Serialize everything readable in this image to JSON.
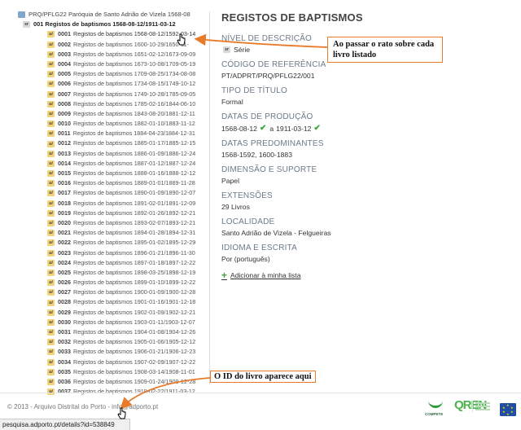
{
  "tree": {
    "root": {
      "code": "PRQ/PFLG22",
      "label": "Paróquia de Santo Adrião de Vizela 1568-08"
    },
    "book": {
      "code": "001",
      "label": "Registos de baptismos 1568-08-12/1911-03-12"
    },
    "items": [
      {
        "code": "0001",
        "label": "Registos de baptismos 1568-08-12/1592-03-14"
      },
      {
        "code": "0002",
        "label": "Registos de baptismos 1600-10-29/1650-11-"
      },
      {
        "code": "0003",
        "label": "Registos de baptismos 1651-02-12/1673-09-09"
      },
      {
        "code": "0004",
        "label": "Registos de baptismos 1673-10-08/1709-05-19"
      },
      {
        "code": "0005",
        "label": "Registos de baptismos 1709-08-25/1734-08-08"
      },
      {
        "code": "0006",
        "label": "Registos de baptismos 1734-08-15/1749-10-12"
      },
      {
        "code": "0007",
        "label": "Registos de baptismos 1749-10-28/1785-09-05"
      },
      {
        "code": "0008",
        "label": "Registos de baptismos 1785-02-16/1844-06-10"
      },
      {
        "code": "0009",
        "label": "Registos de baptismos 1843-08-20/1881-12-11"
      },
      {
        "code": "0010",
        "label": "Registos de baptismos 1882-01-10/1883-11-12"
      },
      {
        "code": "0011",
        "label": "Registos de baptismos 1884-04-23/1884-12-31"
      },
      {
        "code": "0012",
        "label": "Registos de baptismos 1885-01-17/1885-12-15"
      },
      {
        "code": "0013",
        "label": "Registos de baptismos 1886-01-09/1886-12-24"
      },
      {
        "code": "0014",
        "label": "Registos de baptismos 1887-01-12/1887-12-24"
      },
      {
        "code": "0015",
        "label": "Registos de baptismos 1888-01-16/1888-12-12"
      },
      {
        "code": "0016",
        "label": "Registos de baptismos 1889-01-01/1889-11-28"
      },
      {
        "code": "0017",
        "label": "Registos de baptismos 1890-01-09/1890-12-07"
      },
      {
        "code": "0018",
        "label": "Registos de baptismos 1891-02-01/1891-12-09"
      },
      {
        "code": "0019",
        "label": "Registos de baptismos 1892-01-26/1892-12-21"
      },
      {
        "code": "0020",
        "label": "Registos de baptismos 1893-02-07/1893-12-21"
      },
      {
        "code": "0021",
        "label": "Registos de baptismos 1894-01-28/1894-12-31"
      },
      {
        "code": "0022",
        "label": "Registos de baptismos 1895-01-02/1895-12-29"
      },
      {
        "code": "0023",
        "label": "Registos de baptismos 1896-01-21/1896-11-30"
      },
      {
        "code": "0024",
        "label": "Registos de baptismos 1897-01-18/1897-12-22"
      },
      {
        "code": "0025",
        "label": "Registos de baptismos 1898-03-25/1898-12-19"
      },
      {
        "code": "0026",
        "label": "Registos de baptismos 1899-01-10/1899-12-22"
      },
      {
        "code": "0027",
        "label": "Registos de baptismos 1900-01-09/1900-12-28"
      },
      {
        "code": "0028",
        "label": "Registos de baptismos 1901-01-16/1901-12-18"
      },
      {
        "code": "0029",
        "label": "Registos de baptismos 1902-01-09/1902-12-21"
      },
      {
        "code": "0030",
        "label": "Registos de baptismos 1903-01-11/1903-12-07"
      },
      {
        "code": "0031",
        "label": "Registos de baptismos 1904-01-08/1904-12-26"
      },
      {
        "code": "0032",
        "label": "Registos de baptismos 1905-01-06/1905-12-12"
      },
      {
        "code": "0033",
        "label": "Registos de baptismos 1906-01-21/1906-12-23"
      },
      {
        "code": "0034",
        "label": "Registos de baptismos 1907-02-09/1907-12-22"
      },
      {
        "code": "0035",
        "label": "Registos de baptismos 1908-03-14/1908-11-01"
      },
      {
        "code": "0036",
        "label": "Registos de baptismos 1909-01-24/1909-12-28"
      },
      {
        "code": "0037",
        "label": "Registos de baptismos 1910-02-22/1911-03-12"
      }
    ]
  },
  "detail": {
    "title": "REGISTOS DE BAPTISMOS",
    "nivel_label": "NÍVEL DE DESCRIÇÃO",
    "nivel_value": "Série",
    "codigo_label": "CÓDIGO DE REFERÊNCIA",
    "codigo_value": "PT/ADPRT/PRQ/PFLG22/001",
    "tipo_label": "TIPO DE TÍTULO",
    "tipo_value": "Formal",
    "datas_prod_label": "DATAS DE PRODUÇÃO",
    "datas_prod_start": "1568-08-12",
    "datas_prod_mid": "a",
    "datas_prod_end": "1911-03-12",
    "datas_pred_label": "DATAS PREDOMINANTES",
    "datas_pred_value": "1568-1592, 1600-1883",
    "dimensao_label": "DIMENSÃO E SUPORTE",
    "dimensao_value": "Papel",
    "extensoes_label": "EXTENSÕES",
    "extensoes_value": "29 Livros",
    "localidade_label": "LOCALIDADE",
    "localidade_value": "Santo Adrião de Vizela - Felgueiras",
    "idioma_label": "IDIOMA E ESCRITA",
    "idioma_value": "Por (português)",
    "add_list_label": "Adicionar à minha lista"
  },
  "footer": {
    "copyright": "© 2013 - Arquivo Distrital do Porto - info@adporto.pt",
    "logo_compete": "COMPETE",
    "logo_qren": "QREN"
  },
  "statusbar": {
    "url": "pesquisa.adporto.pt/details?id=538849"
  },
  "annotations": {
    "top": "Ao passar o rato sobre cada livro listado",
    "bottom": "O ID do livro aparece aqui"
  },
  "colors": {
    "accent_orange": "#e87a2a",
    "check_green": "#3aa83a",
    "label_gray": "#6c7a89"
  }
}
